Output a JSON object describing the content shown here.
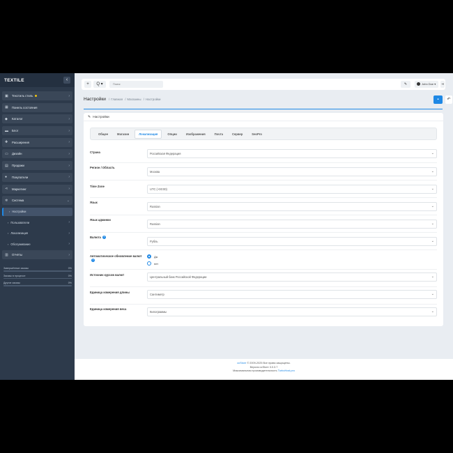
{
  "sidebar": {
    "brand": "TEXTILE",
    "toggle_icon": "chevron-left-icon",
    "items": [
      {
        "label": "Текстиль стиль",
        "icon": "monitor-icon"
      },
      {
        "label": "Панель состояния",
        "icon": "dashboard-icon"
      },
      {
        "label": "Каталог",
        "icon": "tag-icon"
      },
      {
        "label": "Блог",
        "icon": "folder-icon"
      },
      {
        "label": "Расширения",
        "icon": "puzzle-icon"
      },
      {
        "label": "Дизайн",
        "icon": "desktop-icon"
      },
      {
        "label": "Продажи",
        "icon": "cart-icon"
      },
      {
        "label": "Покупатели",
        "icon": "user-icon"
      },
      {
        "label": "Маркетинг",
        "icon": "share-icon"
      },
      {
        "label": "Система",
        "icon": "gear-icon"
      }
    ],
    "subitems": [
      {
        "label": "Настройки"
      },
      {
        "label": "Пользователи"
      },
      {
        "label": "Локализация"
      },
      {
        "label": "Обслуживание"
      }
    ],
    "reports": {
      "label": "Отчёты",
      "icon": "chart-icon"
    },
    "progress": [
      {
        "label": "Завершённые заказы",
        "value": "0%",
        "fraction": 0
      },
      {
        "label": "Заказы в процессе",
        "value": "0%",
        "fraction": 0
      },
      {
        "label": "Другие заказы",
        "value": "0%",
        "fraction": 0
      }
    ]
  },
  "topbar": {
    "add_label": "+",
    "search_dropdown": "Q ▾",
    "search_placeholder": "Поиск",
    "user_name": "John Doe"
  },
  "header": {
    "title": "Настройки",
    "breadcrumbs": [
      "Главная",
      "Магазины",
      "Настройки"
    ]
  },
  "card": {
    "title": "Настройки",
    "tabs": [
      "Общее",
      "Магазин",
      "Локализация",
      "Опции",
      "Изображения",
      "Почта",
      "Сервер",
      "SeoPro"
    ],
    "active_tab": "Локализация"
  },
  "form": {
    "country": {
      "label": "Страна",
      "value": "Российская Федерация"
    },
    "region": {
      "label": "Регион / Область",
      "value": "Москва"
    },
    "timezone": {
      "label": "Time Zone",
      "value": "UTC (+00:00)"
    },
    "language": {
      "label": "Язык",
      "value": "Russian"
    },
    "admin_language": {
      "label": "Язык админки",
      "value": "Russian"
    },
    "currency": {
      "label": "Валюта",
      "value": "Рубль"
    },
    "auto_update": {
      "label": "Автоматическое обновление валют",
      "yes": "Да",
      "no": "нет",
      "selected": "Да"
    },
    "rate_source": {
      "label": "Источник курсов валют",
      "value": "Центральный банк Российской Федерации"
    },
    "length_unit": {
      "label": "Единица измерения длины",
      "value": "Сантиметр"
    },
    "weight_unit": {
      "label": "Единица измерения веса",
      "value": "Килограммы"
    }
  },
  "footer": {
    "link": "ocStore",
    "copyright": "© 2009-2025 Все права защищены.",
    "version": "Версия ocStore 3.0.3.7",
    "perf_text": "Максимальная производительность",
    "perf_link": "TurboHost.pro"
  }
}
